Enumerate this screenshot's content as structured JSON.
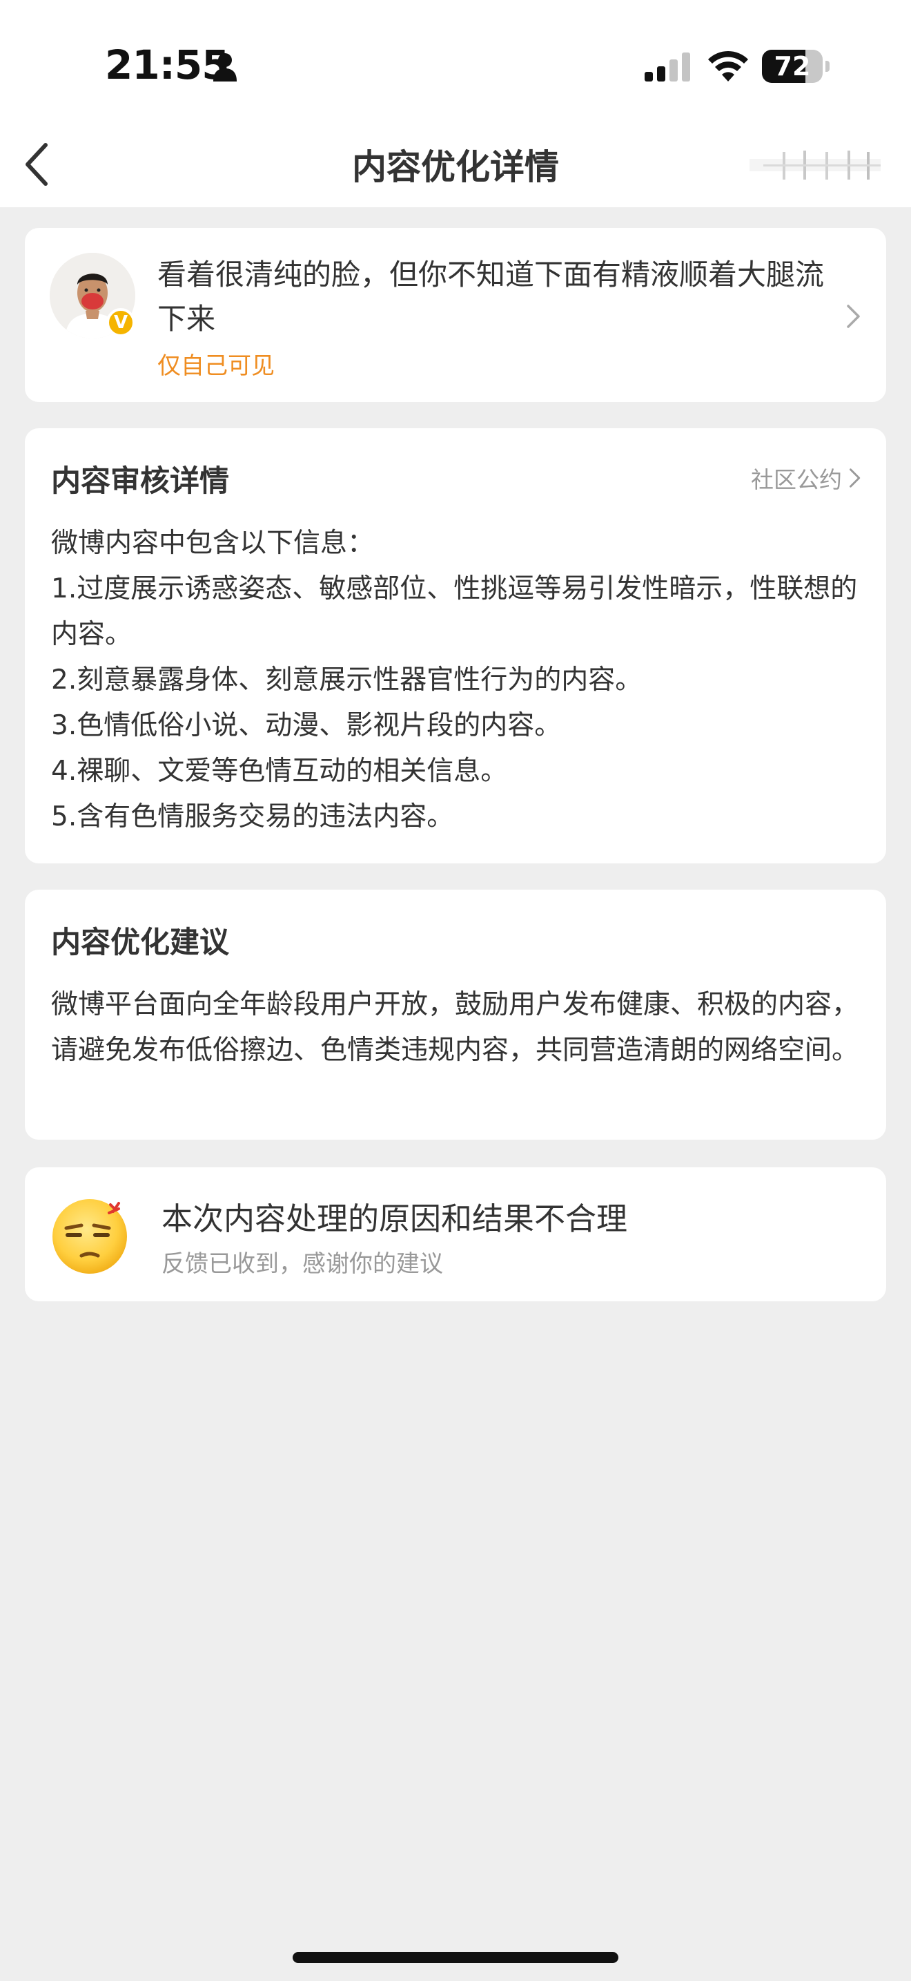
{
  "status_bar": {
    "time": "21:55",
    "battery_level": 72,
    "battery_text": "72",
    "signal_bars_active": 2,
    "signal_bars_total": 4
  },
  "nav": {
    "title": "内容优化详情",
    "back_icon": "chevron-left-icon"
  },
  "post": {
    "text": "看着很清纯的脸，但你不知道下面有精液顺着大腿流下来",
    "visibility": "仅自己可见",
    "verified_badge": "V",
    "accent_color": "#ef8d21"
  },
  "review": {
    "title": "内容审核详情",
    "link_label": "社区公约",
    "lines": [
      "微博内容中包含以下信息：",
      "1.过度展示诱惑姿态、敏感部位、性挑逗等易引发性暗示，性联想的内容。",
      "2.刻意暴露身体、刻意展示性器官性行为的内容。",
      "3.色情低俗小说、动漫、影视片段的内容。",
      "4.裸聊、文爱等色情互动的相关信息。",
      "5.含有色情服务交易的违法内容。"
    ]
  },
  "advice": {
    "title": "内容优化建议",
    "text": "微博平台面向全年龄段用户开放，鼓励用户发布健康、积极的内容，请避免发布低俗擦边、色情类违规内容，共同营造清朗的网络空间。"
  },
  "feedback": {
    "title": "本次内容处理的原因和结果不合理",
    "subtitle": "反馈已收到，感谢你的建议",
    "icon": "annoyed-face-emoji"
  },
  "colors": {
    "background": "#eeeeee",
    "card": "#ffffff",
    "text_primary": "#333333",
    "text_secondary": "#999999",
    "badge": "#f5b400"
  }
}
